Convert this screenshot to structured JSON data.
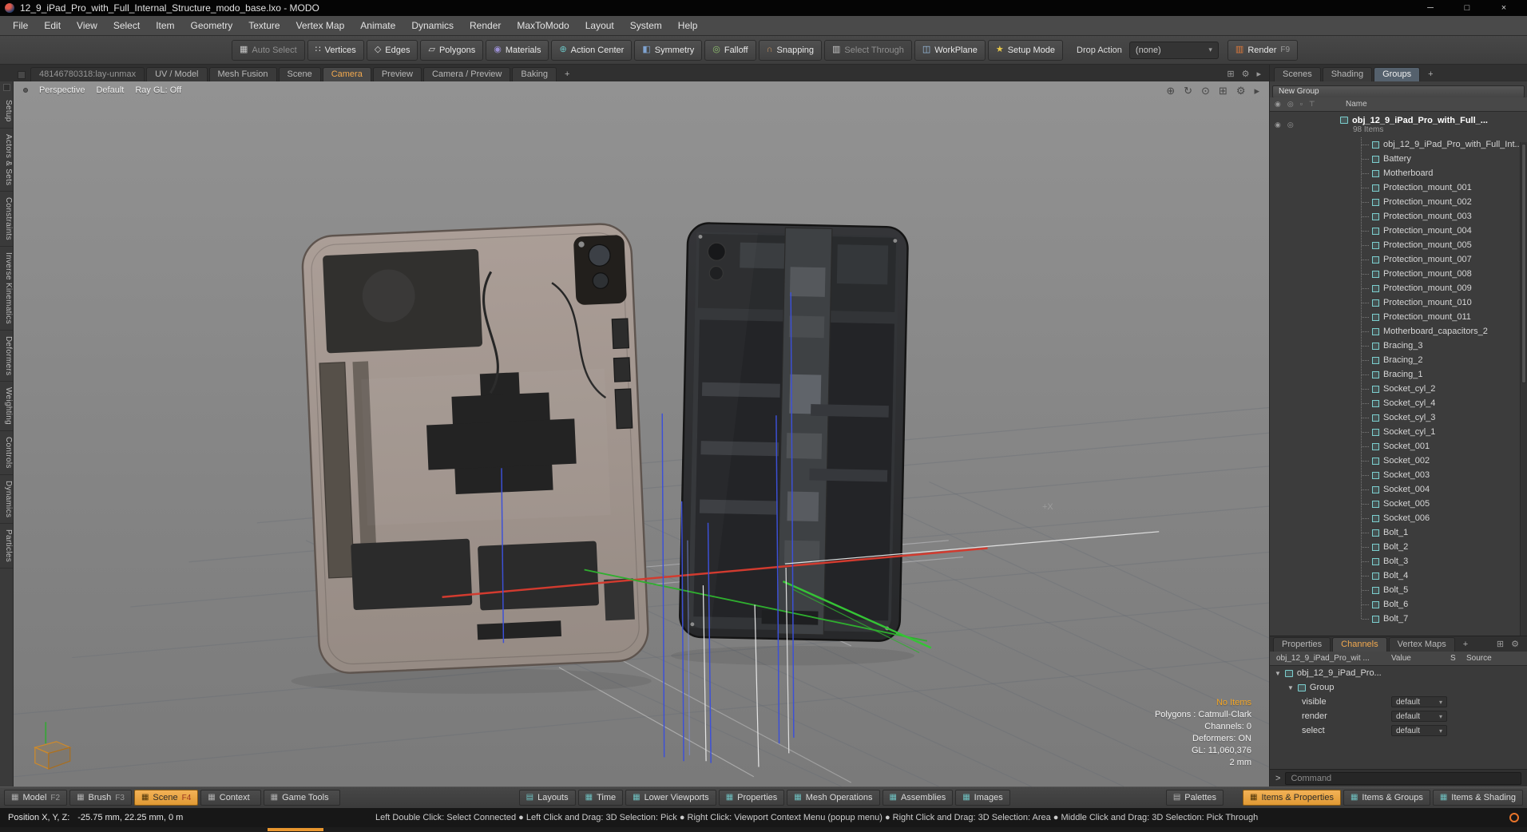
{
  "window": {
    "title": "12_9_iPad_Pro_with_Full_Internal_Structure_modo_base.lxo - MODO",
    "minimize": "─",
    "maximize": "□",
    "close": "×"
  },
  "menu_bar": {
    "items": [
      "File",
      "Edit",
      "View",
      "Select",
      "Item",
      "Geometry",
      "Texture",
      "Vertex Map",
      "Animate",
      "Dynamics",
      "Render",
      "MaxToModo",
      "Layout",
      "System",
      "Help"
    ]
  },
  "toolbar": {
    "buttons": [
      {
        "label": "Auto Select",
        "icon": "▦",
        "disabled": true
      },
      {
        "label": "Vertices",
        "icon": "∷",
        "icon_color": "#d8d8d8"
      },
      {
        "label": "Edges",
        "icon": "◇",
        "icon_color": "#d8d8d8"
      },
      {
        "label": "Polygons",
        "icon": "▱",
        "icon_color": "#d8d8d8"
      },
      {
        "label": "Materials",
        "icon": "◉",
        "icon_color": "#9b8fd4"
      },
      {
        "label": "Action Center",
        "icon": "⊕",
        "icon_color": "#6cc5c5"
      },
      {
        "label": "Symmetry",
        "icon": "◧",
        "icon_color": "#7fa3d0"
      },
      {
        "label": "Falloff",
        "icon": "◎",
        "icon_color": "#8fbf6f"
      },
      {
        "label": "Snapping",
        "icon": "∩",
        "icon_color": "#c8925f"
      },
      {
        "label": "Select Through",
        "icon": "▥",
        "disabled": true
      },
      {
        "label": "WorkPlane",
        "icon": "◫",
        "icon_color": "#9fc4e8"
      },
      {
        "label": "Setup Mode",
        "icon": "★",
        "icon_color": "#e8c84a"
      }
    ],
    "drop_action_label": "Drop Action",
    "drop_action_value": "(none)",
    "drop_action_caret": "▾",
    "render": {
      "icon": "▥",
      "label": "Render",
      "key": "F9"
    }
  },
  "tab_strip": {
    "session": "48146780318:lay-unmax",
    "tabs": [
      {
        "label": "UV / Model"
      },
      {
        "label": "Mesh Fusion"
      },
      {
        "label": "Scene"
      },
      {
        "label": "Camera",
        "active": true
      },
      {
        "label": "Preview"
      },
      {
        "label": "Camera / Preview"
      },
      {
        "label": "Baking"
      }
    ],
    "add": "+",
    "icons": [
      {
        "name": "dock-icon",
        "glyph": "⊞"
      },
      {
        "name": "settings-icon",
        "glyph": "⚙"
      },
      {
        "name": "expand-icon",
        "glyph": "▸"
      }
    ]
  },
  "right_tab_strip": {
    "tabs": [
      {
        "label": "Scenes"
      },
      {
        "label": "Shading"
      },
      {
        "label": "Groups",
        "active": true
      }
    ],
    "add": "+"
  },
  "left_dock": {
    "items": [
      "Setup",
      "Actors & Sets",
      "Constraints",
      "Inverse Kinematics",
      "Deformers",
      "Weighting",
      "Controls",
      "Dynamics",
      "Particles"
    ]
  },
  "viewport": {
    "mode": "Perspective",
    "camera": "Default",
    "raygl": "Ray GL: Off",
    "axis_label": "+X",
    "nav_icons": [
      {
        "name": "pan-icon",
        "glyph": "⊕"
      },
      {
        "name": "rotate-icon",
        "glyph": "↻"
      },
      {
        "name": "zoom-icon",
        "glyph": "⊙"
      },
      {
        "name": "frame-icon",
        "glyph": "⊞"
      },
      {
        "name": "options-icon",
        "glyph": "⚙"
      },
      {
        "name": "expand-icon",
        "glyph": "▸"
      }
    ],
    "stats": {
      "highlight": "No Items",
      "lines": [
        "Polygons : Catmull-Clark",
        "Channels: 0",
        "Deformers: ON",
        "GL: 11,060,376",
        "2 mm"
      ]
    }
  },
  "groups_panel": {
    "new_group_button": "New Group",
    "header": {
      "name": "Name",
      "icons": [
        {
          "name": "visibility-icon",
          "glyph": "◉"
        },
        {
          "name": "render-visibility-icon",
          "glyph": "◎"
        },
        {
          "name": "lock-icon",
          "glyph": "▫"
        },
        {
          "name": "filter-icon",
          "glyph": "⊤"
        }
      ]
    },
    "root_item": {
      "eye_icon": "◉",
      "eye_icon2": "◎",
      "label": "obj_12_9_iPad_Pro_with_Full_...",
      "count": "98 Items"
    },
    "items": [
      "obj_12_9_iPad_Pro_with_Full_Int...",
      "Battery",
      "Motherboard",
      "Protection_mount_001",
      "Protection_mount_002",
      "Protection_mount_003",
      "Protection_mount_004",
      "Protection_mount_005",
      "Protection_mount_007",
      "Protection_mount_008",
      "Protection_mount_009",
      "Protection_mount_010",
      "Protection_mount_011",
      "Motherboard_capacitors_2",
      "Bracing_3",
      "Bracing_2",
      "Bracing_1",
      "Socket_cyl_2",
      "Socket_cyl_4",
      "Socket_cyl_3",
      "Socket_cyl_1",
      "Socket_001",
      "Socket_002",
      "Socket_003",
      "Socket_004",
      "Socket_005",
      "Socket_006",
      "Bolt_1",
      "Bolt_2",
      "Bolt_3",
      "Bolt_4",
      "Bolt_5",
      "Bolt_6",
      "Bolt_7"
    ]
  },
  "channels_panel": {
    "tabs": [
      {
        "label": "Properties"
      },
      {
        "label": "Channels",
        "active": true
      },
      {
        "label": "Vertex Maps"
      }
    ],
    "add": "+",
    "icons": [
      {
        "name": "dock-icon",
        "glyph": "⊞"
      },
      {
        "name": "settings-icon",
        "glyph": "⚙"
      }
    ],
    "columns": {
      "name": "obj_12_9_iPad_Pro_wit ...",
      "value": "Value",
      "s": "S",
      "source": "Source"
    },
    "item_row": "obj_12_9_iPad_Pro...",
    "group_row": "Group",
    "channels": [
      {
        "name": "visible",
        "value": "default"
      },
      {
        "name": "render",
        "value": "default"
      },
      {
        "name": "select",
        "value": "default"
      }
    ],
    "command_prompt": ">",
    "command_placeholder": "Command"
  },
  "bottom_bar": {
    "left": [
      {
        "label": "Model",
        "key": "F2",
        "icon": "▦"
      },
      {
        "label": "Brush",
        "key": "F3",
        "icon": "▦"
      },
      {
        "label": "Scene",
        "key": "F4",
        "icon": "▦",
        "active": true
      },
      {
        "label": "Context",
        "icon": "▦"
      },
      {
        "label": "Game Tools",
        "icon": "▦"
      }
    ],
    "center": [
      {
        "label": "Layouts",
        "icon": "▤"
      },
      {
        "label": "Time",
        "icon": "▦"
      },
      {
        "label": "Lower Viewports",
        "icon": "▦"
      },
      {
        "label": "Properties",
        "icon": "▦"
      },
      {
        "label": "Mesh Operations",
        "icon": "▦"
      },
      {
        "label": "Assemblies",
        "icon": "▦"
      },
      {
        "label": "Images",
        "icon": "▦"
      }
    ],
    "palettes": {
      "label": "Palettes",
      "icon": "▤"
    },
    "right": [
      {
        "label": "Items & Properties",
        "icon": "▦",
        "active": true
      },
      {
        "label": "Items & Groups",
        "icon": "▦"
      },
      {
        "label": "Items & Shading",
        "icon": "▦"
      }
    ]
  },
  "status_bar": {
    "position_label": "Position X, Y, Z:",
    "position_value": "-25.75 mm, 22.25 mm, 0 m",
    "hints": "Left Double Click: Select Connected  ●  Left Click and Drag: 3D Selection: Pick  ●  Right Click: Viewport Context Menu (popup menu)  ●  Right Click and Drag: 3D Selection: Area  ●  Middle Click and Drag: 3D Selection: Pick Through"
  },
  "colors": {
    "accent_orange": "#e8a33d",
    "active_tab_text": "#f2a94f",
    "axis_red": "#d23b2f",
    "axis_green": "#2fae2f",
    "axis_blue": "#3c50d8"
  }
}
